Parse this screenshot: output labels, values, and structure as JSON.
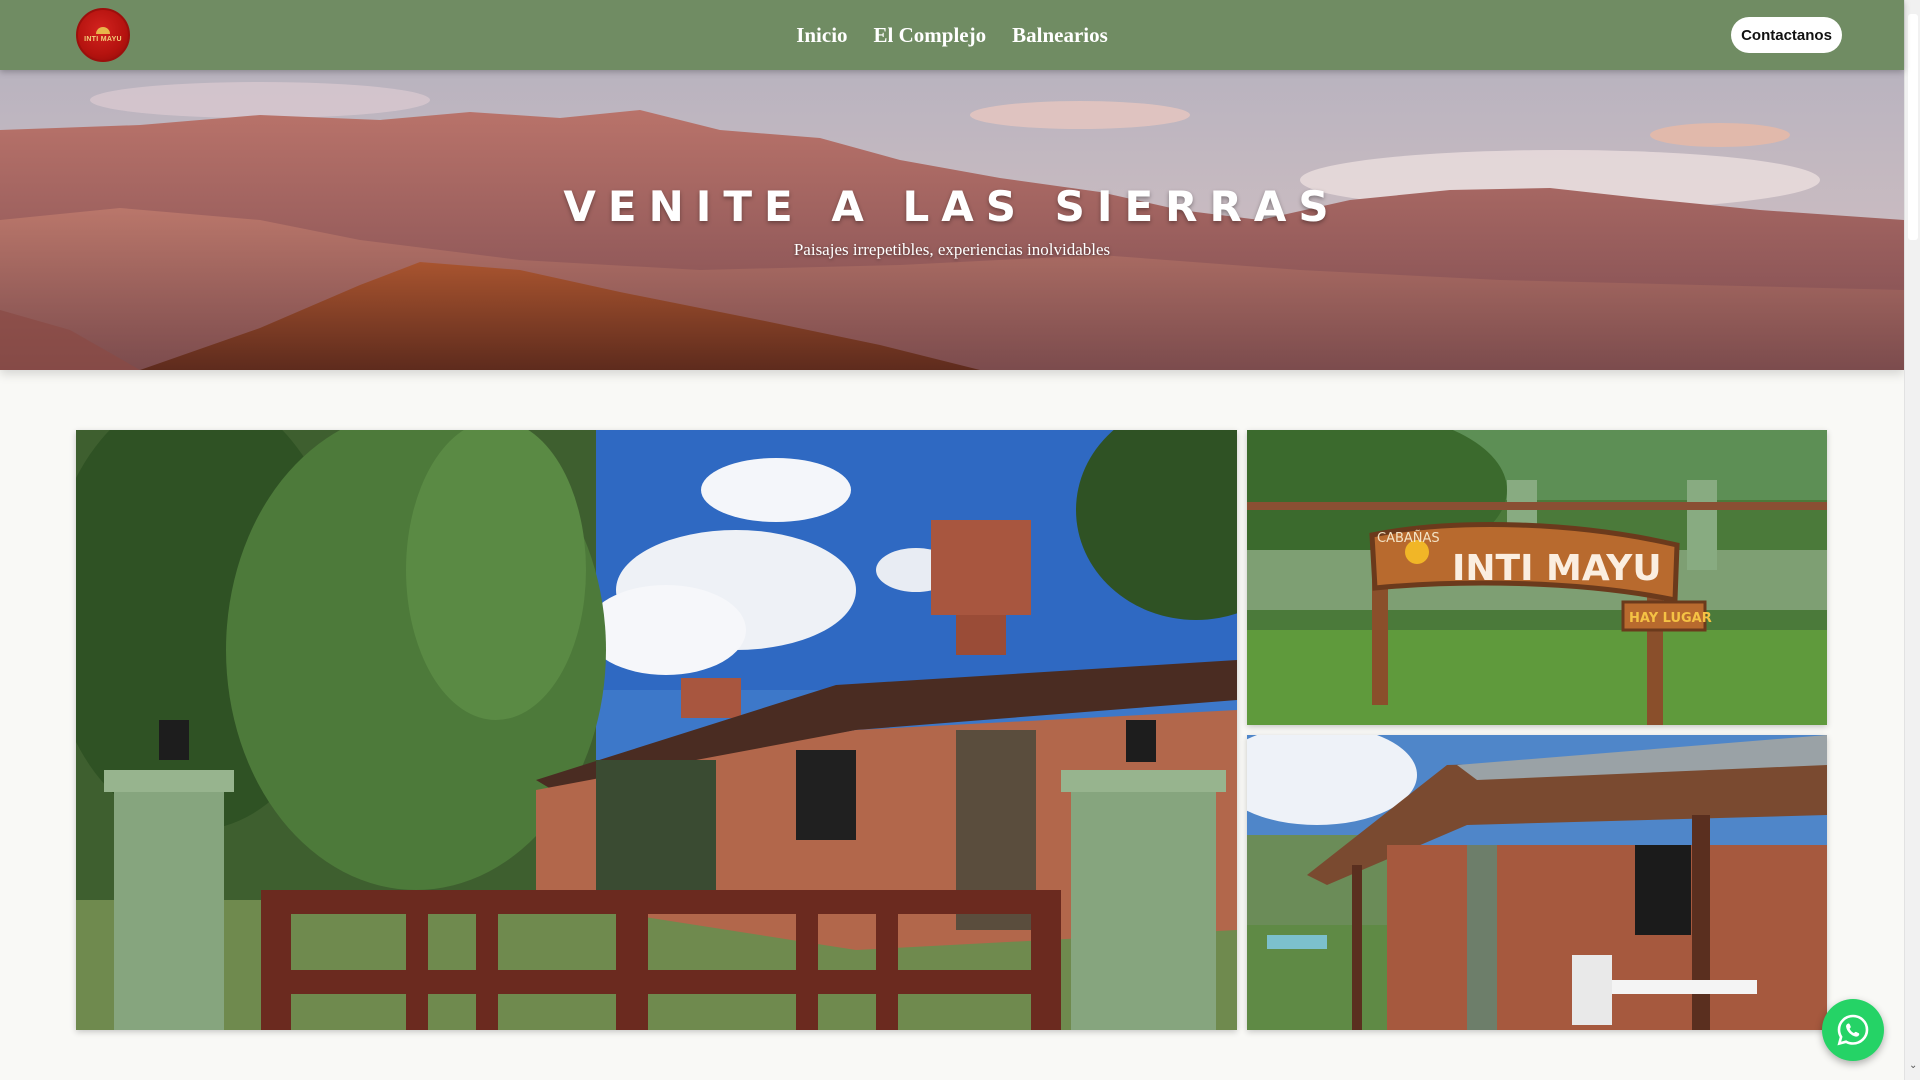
{
  "brand": {
    "logo_text": "INTI MAYU",
    "colors": {
      "nav_bg": "#708c63",
      "logo_red": "#b5130f",
      "whatsapp": "#25d366"
    }
  },
  "nav": {
    "links": [
      "Inicio",
      "El Complejo",
      "Balnearios"
    ],
    "cta": "Contactanos"
  },
  "hero": {
    "title": "VENITE A LAS SIERRAS",
    "subtitle": "Paisajes irrepetibles, experiencias inolvidables",
    "image": "mountain-sunset-photo"
  },
  "gallery": {
    "images": [
      {
        "name": "cabin-entrance-gate-photo"
      },
      {
        "name": "inti-mayu-sign-photo",
        "sign_small": "CABAÑAS",
        "sign_main": "INTI MAYU",
        "sign_tag": "HAY LUGAR"
      },
      {
        "name": "cabin-porch-photo"
      }
    ]
  },
  "floating": {
    "whatsapp_icon": "whatsapp-icon"
  }
}
